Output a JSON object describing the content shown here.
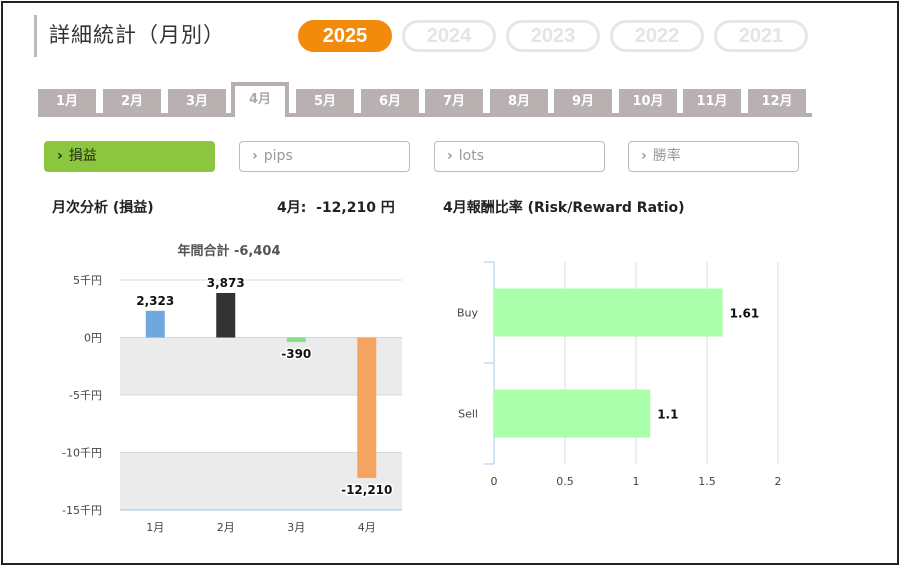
{
  "page_title": "詳細統計（月別）",
  "years": [
    "2025",
    "2024",
    "2023",
    "2022",
    "2021"
  ],
  "active_year": "2025",
  "months": [
    "1月",
    "2月",
    "3月",
    "4月",
    "5月",
    "6月",
    "7月",
    "8月",
    "9月",
    "10月",
    "11月",
    "12月"
  ],
  "active_month": "4月",
  "metrics": [
    {
      "label": "損益",
      "active": true
    },
    {
      "label": "pips",
      "active": false
    },
    {
      "label": "lots",
      "active": false
    },
    {
      "label": "勝率",
      "active": false
    }
  ],
  "left_section": {
    "title": "月次分析 (損益)",
    "month_label": "4月:",
    "month_value": "-12,210 円"
  },
  "right_section": {
    "title": "4月報酬比率 (Risk/Reward Ratio)"
  },
  "colors": {
    "accent_orange": "#f28b0c",
    "metric_active": "#8cc63f",
    "tab_gray": "#b9b1b1",
    "bar_blue": "#6fa8dc",
    "bar_dark": "#333333",
    "bar_green": "#88dd88",
    "bar_orange": "#f4a460",
    "hbar_green": "#aaffaa"
  },
  "chart_data": [
    {
      "type": "bar",
      "title": "年間合計 -6,404",
      "categories": [
        "1月",
        "2月",
        "3月",
        "4月"
      ],
      "values": [
        2323,
        3873,
        -390,
        -12210
      ],
      "value_labels": [
        "2,323",
        "3,873",
        "-390",
        "-12,210"
      ],
      "bar_colors": [
        "#6fa8dc",
        "#333333",
        "#88dd88",
        "#f4a460"
      ],
      "y_ticks": [
        5000,
        0,
        -5000,
        -10000,
        -15000
      ],
      "y_tick_labels": [
        "5千円",
        "0円",
        "-5千円",
        "-10千円",
        "-15千円"
      ],
      "ylim": [
        -15000,
        5000
      ],
      "grid": true
    },
    {
      "type": "bar",
      "orientation": "horizontal",
      "categories": [
        "Buy",
        "Sell"
      ],
      "values": [
        1.61,
        1.1
      ],
      "value_labels": [
        "1.61",
        "1.1"
      ],
      "x_ticks": [
        0,
        0.5,
        1,
        1.5,
        2
      ],
      "x_tick_labels": [
        "0",
        "0.5",
        "1",
        "1.5",
        "2"
      ],
      "xlim": [
        0,
        2
      ],
      "grid": true
    }
  ]
}
